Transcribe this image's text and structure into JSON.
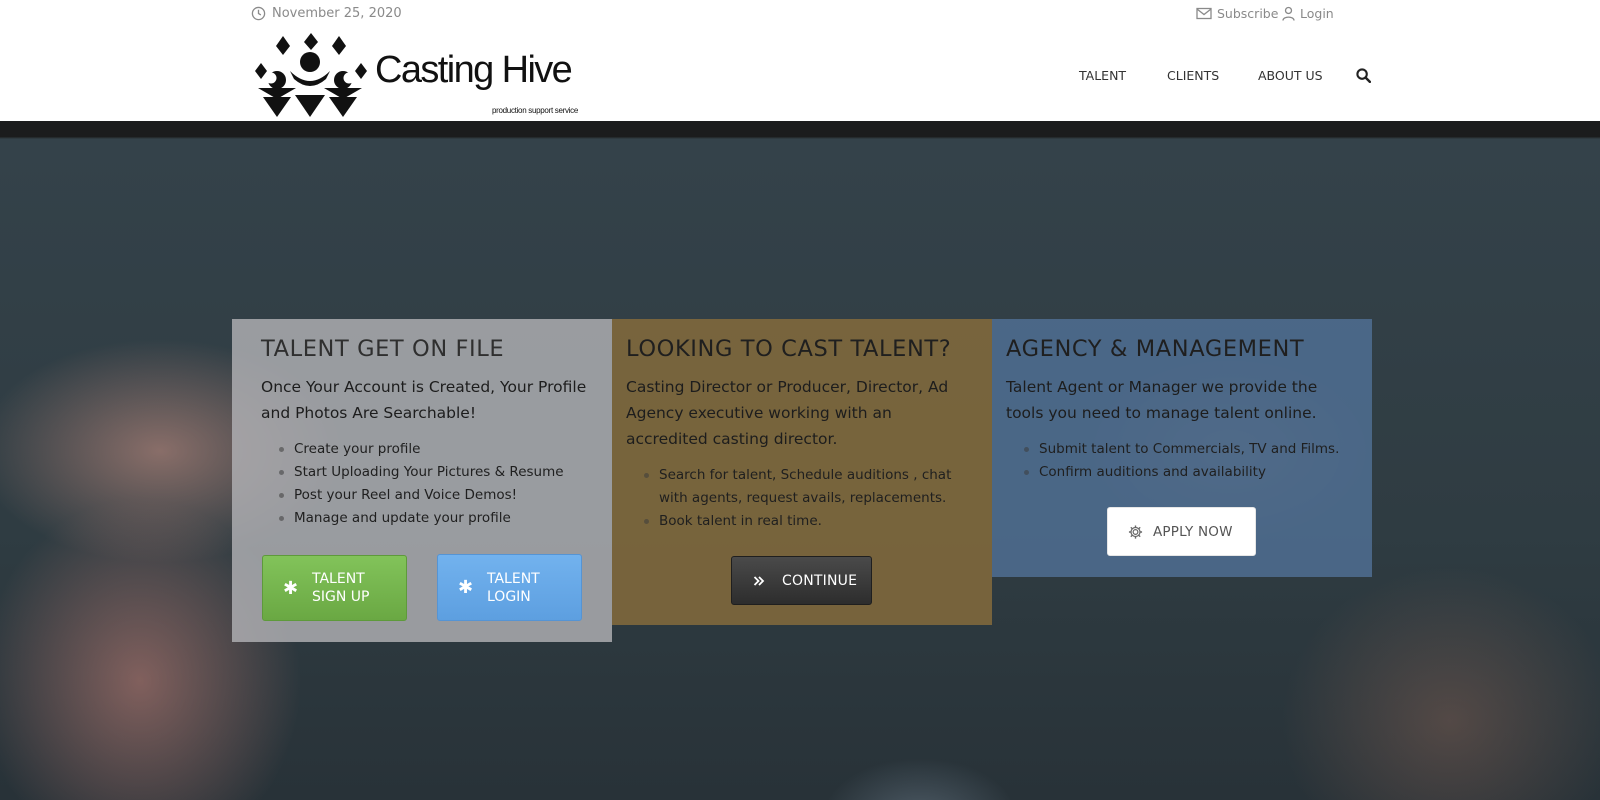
{
  "header": {
    "date": "November 25, 2020",
    "subscribe_label": "Subscribe",
    "login_label": "Login",
    "logo_name": "Casting Hive",
    "logo_tagline": "production support service",
    "nav": [
      "TALENT",
      "CLIENTS",
      "ABOUT US"
    ]
  },
  "panels": [
    {
      "title": "TALENT GET ON FILE",
      "intro": "Once Your Account is Created, Your Profile and Photos Are Searchable!",
      "items": [
        "Create your profile",
        "Start Uploading Your Pictures & Resume",
        "Post your Reel and Voice Demos!",
        "Manage and update your profile"
      ],
      "buttons": [
        "TALENT SIGN UP",
        "TALENT LOGIN"
      ]
    },
    {
      "title": "LOOKING TO CAST TALENT?",
      "intro": "Casting Director or Producer, Director,  Ad Agency executive working with an accredited casting director.",
      "items": [
        "Search for talent,  Schedule auditions , chat with agents, request avails, replacements.",
        "Book talent in real time."
      ],
      "button": "CONTINUE"
    },
    {
      "title": "AGENCY & MANAGEMENT",
      "intro": "Talent Agent or Manager we provide the tools you need to manage talent online.",
      "items": [
        "Submit talent to Commercials, TV and Films.",
        "Confirm auditions and availability"
      ],
      "button": "APPLY NOW"
    }
  ],
  "colors": {
    "talent_panel": "#b1b1b5",
    "cast_panel": "#80683c",
    "agency_panel": "#4e6c8e",
    "signup_button": "#78b851",
    "login_button": "#68a8e8",
    "continue_button": "#3a3a3a"
  },
  "icons": [
    "clock-icon",
    "envelope-icon",
    "user-icon",
    "search-icon",
    "asterisk-icon",
    "double-chevron-right-icon",
    "gear-icon"
  ]
}
